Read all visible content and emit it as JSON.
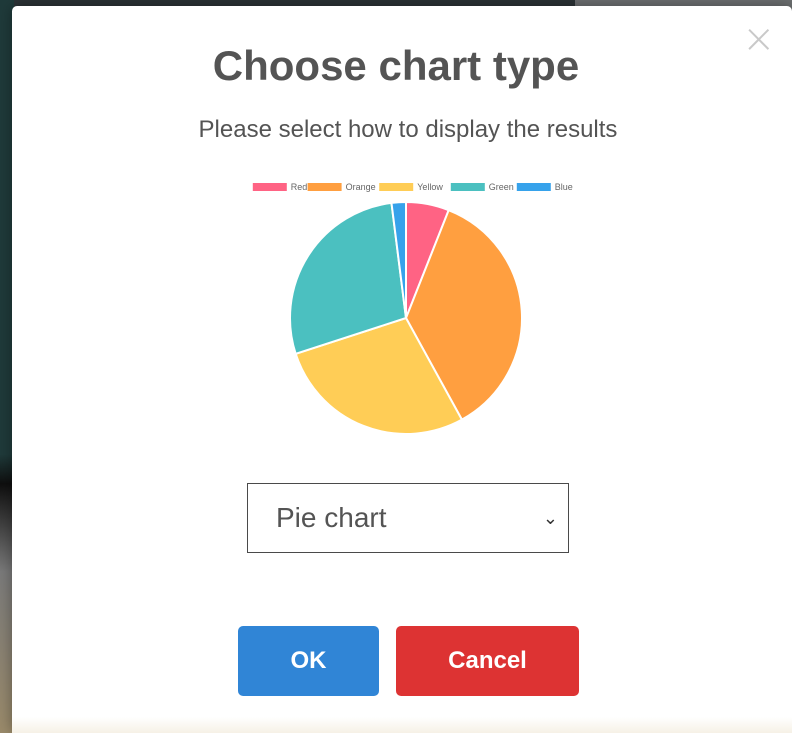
{
  "modal": {
    "title": "Choose chart type",
    "subtitle": "Please select how to display the results",
    "close_glyph": "×",
    "select": {
      "selected": "Pie chart",
      "chevron_glyph": "⌄"
    },
    "buttons": {
      "ok": "OK",
      "cancel": "Cancel"
    },
    "colors": {
      "ok": "#3085d6",
      "cancel": "#dd3333"
    }
  },
  "chart_data": {
    "type": "pie",
    "legend_position": "top",
    "categories": [
      "Red",
      "Orange",
      "Yellow",
      "Green",
      "Blue"
    ],
    "values": [
      6,
      36,
      28,
      28,
      2
    ],
    "colors": [
      "#ff6384",
      "#ff9f40",
      "#ffcd56",
      "#4bc0c0",
      "#36a2eb"
    ]
  }
}
